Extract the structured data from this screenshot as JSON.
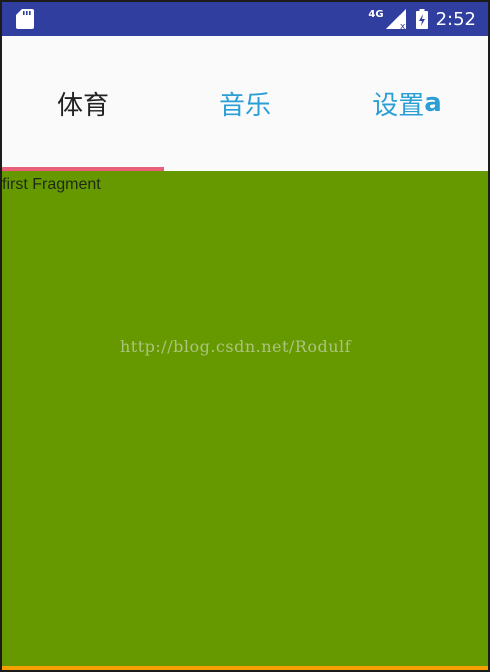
{
  "status_bar": {
    "network": "4G",
    "time": "2:52",
    "icons": [
      "sd-card-icon",
      "signal-icon",
      "battery-icon"
    ]
  },
  "tabs": [
    {
      "label": "体育",
      "suffix": "",
      "selected": true
    },
    {
      "label": "音乐",
      "suffix": "",
      "selected": false
    },
    {
      "label": "设置",
      "suffix": "a",
      "selected": false
    }
  ],
  "content": {
    "fragment_label": "first Fragment",
    "watermark": "http://blog.csdn.net/Rodulf"
  },
  "colors": {
    "status_bar": "#303f9f",
    "tab_active_text": "#222222",
    "tab_inactive_text": "#2a9fd6",
    "indicator": "#e8607a",
    "content_background": "#669900",
    "bottom_strip": "#f5a000"
  }
}
